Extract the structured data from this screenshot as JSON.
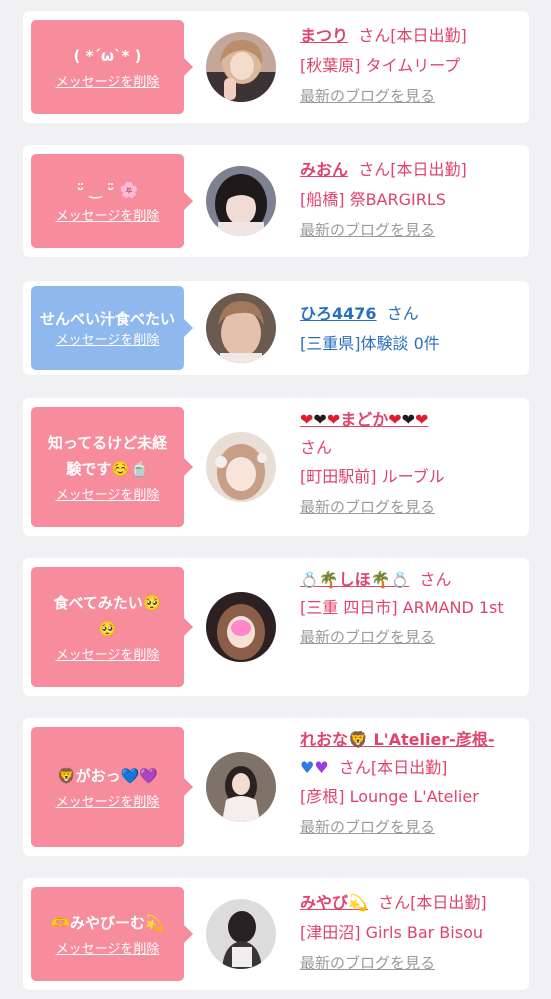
{
  "common": {
    "delete_label": "メッセージを削除",
    "blog_label": "最新のブログを見る",
    "san": "さん"
  },
  "cards": [
    {
      "message": "( *´ω`* )",
      "name": "まつり",
      "status": "[本日出勤]",
      "shop": "[秋葉原] タイムリープ"
    },
    {
      "message": "ᵕ̈ ‿ ᵕ̈ 🌸",
      "name": "みおん",
      "status": "[本日出勤]",
      "shop": "[船橋] 祭BARGIRLS"
    },
    {
      "message": "せんべい汁食べたい",
      "name": "ひろ4476",
      "shop": "[三重県]体験談 0件"
    },
    {
      "message": "知ってるけど未経験です☺️🍵",
      "name": "まどか",
      "shop": "[町田駅前] ルーブル"
    },
    {
      "message": "食べてみたい🥺🥺",
      "name": "しほ",
      "shop": "[三重 四日市] ARMAND 1st"
    },
    {
      "message": "🦁がおっ💙💜",
      "name": "れおな🦁 L'Atelier-彦根-",
      "status": "[本日出勤]",
      "shop": "[彦根] Lounge L'Atelier"
    },
    {
      "message": "🫶みやびーむ💫",
      "name": "みやび💫",
      "status": "[本日出勤]",
      "shop": "[津田沼] Girls Bar Bisou"
    }
  ],
  "colors": {
    "pink_bubble": "#f68c9c",
    "blue_bubble": "#8eb8ee",
    "pink_text": "#e0436b",
    "blue_text": "#2a6fbf",
    "background": "#f1f0f2"
  }
}
